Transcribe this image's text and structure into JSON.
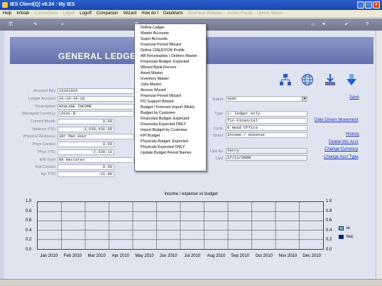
{
  "window": {
    "title": "IES Client(Q) v8.24 : My IES"
  },
  "menu": [
    "Help",
    "Infolab",
    "Connections",
    "Logoff",
    "Logoff",
    "Companion",
    "Wizard",
    "How do I",
    "DataMarts",
    "Business Modules",
    "Action Focus",
    "Option Select"
  ],
  "menu_disabled": [
    false,
    false,
    true,
    true,
    false,
    false,
    false,
    false,
    false,
    true,
    true,
    true
  ],
  "header": {
    "title": "GENERAL LEDGER"
  },
  "form": {
    "account_key_label": "Account Key",
    "account_key": "10101010",
    "ledger_account_label": "Ledger Account",
    "ledger_account": "10-10-10-10",
    "description_label": "*Description",
    "description": "HAULAGE INCOME",
    "managed_currency_label": "Managed Currency",
    "managed_currency": "LOCAL R",
    "current_month_label": "Current Month",
    "current_month": "0.00",
    "balance_ytd_label": "Balance YTD",
    "balance_ytd": "-3,638,436.89",
    "physical_resource_label": "Physical Resource",
    "physical_resource": "ubr Man Hour",
    "phys_current_label": "Phys Current",
    "phys_current": "0.00",
    "phys_ytd_label": "Phys YTD",
    "phys_ytd": "-2,638.13",
    "kpi_type_label": "KPI Type",
    "kpi_type": "HA Hectares",
    "kpi_current_label": "Kpi Current",
    "kpi_current": "0.00",
    "kpi_ytd_label": "Kpi YTD",
    "kpi_ytd": "-22.88",
    "status_label": "Status",
    "status": "open",
    "type_label": "Type",
    "type": "1: ledger only",
    "group_label": "",
    "group": "fin Financial",
    "cycle_label": "Cycle",
    "cycle": "0 Head Office",
    "class_label": "Sheet",
    "class": "income / expense",
    "upd_by_label": "Upd By",
    "upd_by": "Terry",
    "last_upd_label": "Upd",
    "last_upd": "17/11/2009"
  },
  "links": {
    "save": "Save",
    "date_driven": "Date Driven Movement",
    "history": "History",
    "delete": "Delete this Acct",
    "change_currency": "Change Currency",
    "change_type": "Change Acct Type"
  },
  "dropdown_items": [
    "Define Ledger",
    "Master Accounts",
    "Super Accounts",
    "Financial Period Wizard",
    "Define CREDITOR Profile",
    "AR Receivables / Debtors Master",
    "Financials Budget: Expected",
    "Wizard Bank Recons",
    "Asset Master",
    "Inventory Master",
    "Jobs Master",
    "Access Wizard",
    "Financial Period Wizard",
    "PO Support Wizard",
    "Budget / Forecast Import (Multi)",
    "Budget by Customer",
    "Financials Budget: Expected",
    "Financials Expected ONLY",
    "Import Budget by Customer",
    "KPI Budget",
    "Physicals Budget: Expected",
    "Physicals Expected ONLY",
    "Update Budget Period Names"
  ],
  "chart_data": {
    "type": "bar",
    "title": "income / expense vs budget",
    "categories": [
      "Jan 2010",
      "Feb 2010",
      "Mar 2010",
      "Apr 2010",
      "May 2010",
      "Jun 2010",
      "Jul 2010",
      "Aug 2010",
      "Sep 2010",
      "Oct 2010",
      "Nov 2010",
      "Dec 2010"
    ],
    "yticks": [
      "1.0",
      "0.8",
      "0.6",
      "0.4",
      "0.2",
      "0.0"
    ],
    "ylim": [
      0,
      1
    ],
    "series": [
      {
        "name": "ie",
        "color": "#66b2e8",
        "values": [
          0,
          0,
          0,
          0,
          0,
          0,
          0,
          0,
          0,
          0,
          0,
          0
        ]
      },
      {
        "name": "buc",
        "color": "#00209a",
        "values": [
          0,
          0,
          0,
          0,
          0,
          0,
          0,
          0,
          0,
          0,
          0,
          0
        ]
      }
    ],
    "grid": true,
    "legend": "right"
  }
}
